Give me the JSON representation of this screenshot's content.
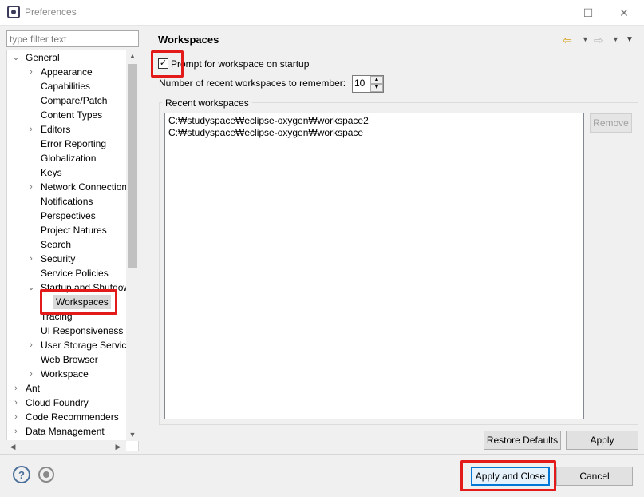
{
  "window": {
    "title": "Preferences",
    "min_glyph": "—",
    "max_glyph": "☐",
    "close_glyph": "✕"
  },
  "filter": {
    "placeholder": "type filter text"
  },
  "tree": {
    "items": [
      {
        "label": "General",
        "twist": "⌄"
      },
      {
        "label": "Appearance",
        "twist": "›"
      },
      {
        "label": "Capabilities",
        "twist": ""
      },
      {
        "label": "Compare/Patch",
        "twist": ""
      },
      {
        "label": "Content Types",
        "twist": ""
      },
      {
        "label": "Editors",
        "twist": "›"
      },
      {
        "label": "Error Reporting",
        "twist": ""
      },
      {
        "label": "Globalization",
        "twist": ""
      },
      {
        "label": "Keys",
        "twist": ""
      },
      {
        "label": "Network Connection",
        "twist": "›"
      },
      {
        "label": "Notifications",
        "twist": ""
      },
      {
        "label": "Perspectives",
        "twist": ""
      },
      {
        "label": "Project Natures",
        "twist": ""
      },
      {
        "label": "Search",
        "twist": ""
      },
      {
        "label": "Security",
        "twist": "›"
      },
      {
        "label": "Service Policies",
        "twist": ""
      },
      {
        "label": "Startup and Shutdown",
        "twist": "⌄"
      },
      {
        "label": "Workspaces",
        "twist": ""
      },
      {
        "label": "Tracing",
        "twist": ""
      },
      {
        "label": "UI Responsiveness M",
        "twist": ""
      },
      {
        "label": "User Storage Service",
        "twist": "›"
      },
      {
        "label": "Web Browser",
        "twist": ""
      },
      {
        "label": "Workspace",
        "twist": "›"
      },
      {
        "label": "Ant",
        "twist": "›"
      },
      {
        "label": "Cloud Foundry",
        "twist": "›"
      },
      {
        "label": "Code Recommenders",
        "twist": "›"
      },
      {
        "label": "Data Management",
        "twist": "›"
      }
    ],
    "selected": "Workspaces"
  },
  "page": {
    "title": "Workspaces",
    "prompt_label": "Prompt for workspace on startup",
    "prompt_checked": true,
    "recent_count_label": "Number of recent workspaces to remember:",
    "recent_count_value": "10",
    "recent_group_label": "Recent workspaces",
    "recent_workspaces": [
      "C:₩studyspace₩eclipse-oxygen₩workspace2",
      "C:₩studyspace₩eclipse-oxygen₩workspace"
    ],
    "remove_label": "Remove",
    "restore_defaults_label": "Restore Defaults",
    "apply_label": "Apply"
  },
  "footer": {
    "apply_close_label": "Apply and Close",
    "cancel_label": "Cancel"
  },
  "icons": {
    "help": "help-icon",
    "import": "import-export-icon",
    "back": "back-arrow-icon",
    "forward": "forward-arrow-icon",
    "view_menu": "view-menu-icon"
  },
  "colors": {
    "highlight": "#e21a1a",
    "default_button_border": "#0078d7"
  }
}
